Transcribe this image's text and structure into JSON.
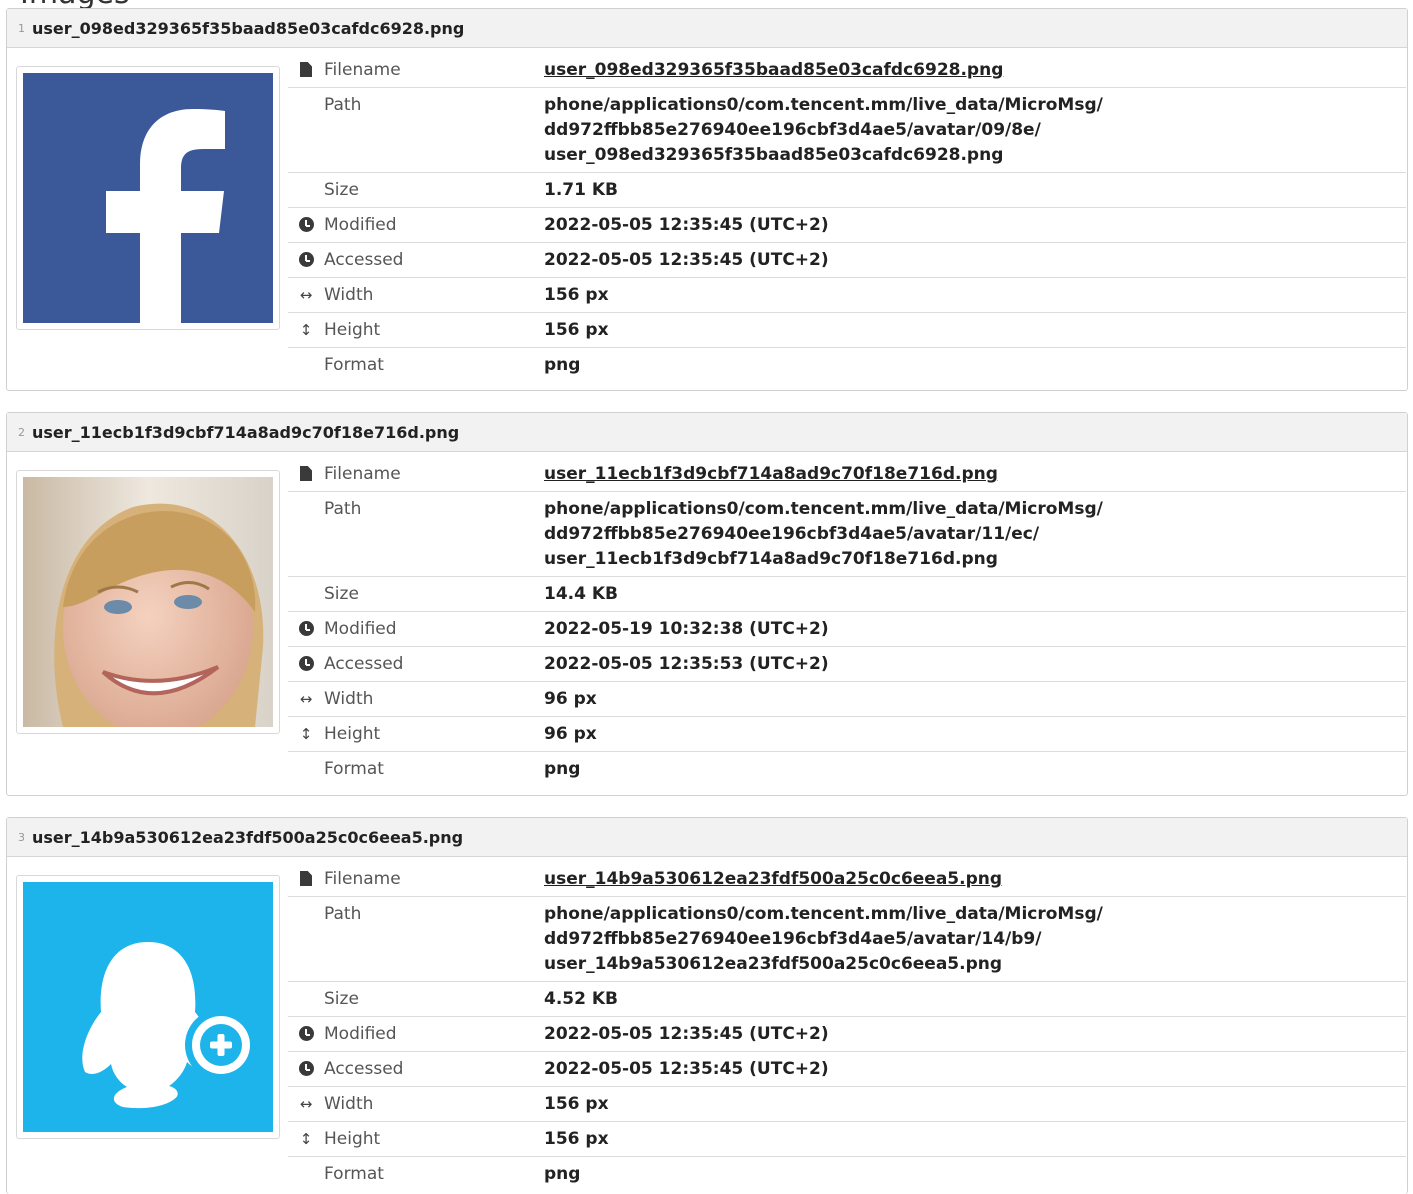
{
  "page": {
    "title": "Images"
  },
  "labels": {
    "filename": "Filename",
    "path": "Path",
    "size": "Size",
    "modified": "Modified",
    "accessed": "Accessed",
    "width": "Width",
    "height": "Height",
    "format": "Format"
  },
  "entries": [
    {
      "index": "1",
      "title": "user_098ed329365f35baad85e03cafdc6928.png",
      "thumbnail": "facebook-logo",
      "filename": "user_098ed329365f35baad85e03cafdc6928.png",
      "path_lines": [
        "phone/applications0/com.tencent.mm/live_data/MicroMsg/",
        "dd972ffbb85e276940ee196cbf3d4ae5/avatar/09/8e/",
        "user_098ed329365f35baad85e03cafdc6928.png"
      ],
      "size": "1.71 KB",
      "modified": "2022-05-05 12:35:45 (UTC+2)",
      "accessed": "2022-05-05 12:35:45 (UTC+2)",
      "width": "156 px",
      "height": "156 px",
      "format": "png"
    },
    {
      "index": "2",
      "title": "user_11ecb1f3d9cbf714a8ad9c70f18e716d.png",
      "thumbnail": "woman-portrait",
      "filename": "user_11ecb1f3d9cbf714a8ad9c70f18e716d.png",
      "path_lines": [
        "phone/applications0/com.tencent.mm/live_data/MicroMsg/",
        "dd972ffbb85e276940ee196cbf3d4ae5/avatar/11/ec/",
        "user_11ecb1f3d9cbf714a8ad9c70f18e716d.png"
      ],
      "size": "14.4 KB",
      "modified": "2022-05-19 10:32:38 (UTC+2)",
      "accessed": "2022-05-05 12:35:53 (UTC+2)",
      "width": "96 px",
      "height": "96 px",
      "format": "png"
    },
    {
      "index": "3",
      "title": "user_14b9a530612ea23fdf500a25c0c6eea5.png",
      "thumbnail": "qq-add-contact-logo",
      "filename": "user_14b9a530612ea23fdf500a25c0c6eea5.png",
      "path_lines": [
        "phone/applications0/com.tencent.mm/live_data/MicroMsg/",
        "dd972ffbb85e276940ee196cbf3d4ae5/avatar/14/b9/",
        "user_14b9a530612ea23fdf500a25c0c6eea5.png"
      ],
      "size": "4.52 KB",
      "modified": "2022-05-05 12:35:45 (UTC+2)",
      "accessed": "2022-05-05 12:35:45 (UTC+2)",
      "width": "156 px",
      "height": "156 px",
      "format": "png"
    }
  ],
  "colors": {
    "facebook_blue": "#3b5998",
    "qq_blue": "#1cb4ea"
  },
  "icons": {
    "filename": "file-icon",
    "modified": "clock-icon",
    "accessed": "clock-icon",
    "width": "arrows-horizontal-icon",
    "height": "arrows-vertical-icon"
  }
}
